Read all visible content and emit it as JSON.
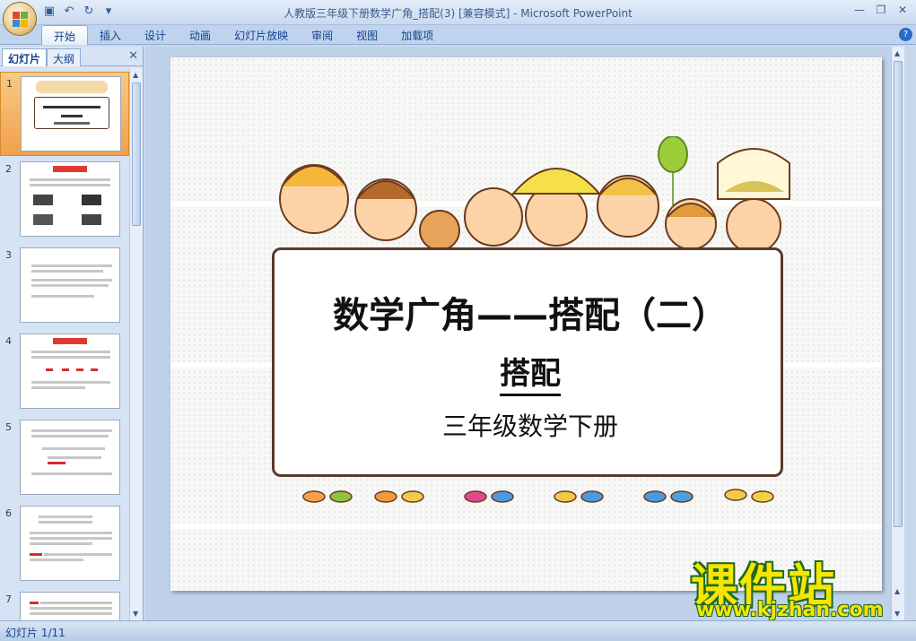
{
  "window": {
    "title": "人教版三年级下册数学广角_搭配(3) [兼容模式] - Microsoft PowerPoint"
  },
  "quick_access": {
    "icons": [
      "save-icon",
      "undo-icon",
      "redo-icon",
      "customize-icon"
    ]
  },
  "ribbon": {
    "tabs": [
      "开始",
      "插入",
      "设计",
      "动画",
      "幻灯片放映",
      "审阅",
      "视图",
      "加载项"
    ],
    "active_tab": "开始"
  },
  "panel": {
    "tab_slides": "幻灯片",
    "tab_outline": "大纲",
    "thumbnails": [
      {
        "number": "1",
        "selected": true
      },
      {
        "number": "2",
        "selected": false
      },
      {
        "number": "3",
        "selected": false
      },
      {
        "number": "4",
        "selected": false
      },
      {
        "number": "5",
        "selected": false
      },
      {
        "number": "6",
        "selected": false
      },
      {
        "number": "7",
        "selected": false
      }
    ]
  },
  "slide": {
    "title": "数学广角——搭配（二）",
    "subtitle": "搭配",
    "grade": "三年级数学下册"
  },
  "watermark": {
    "text": "课件站",
    "url": "www.kjzhan.com"
  },
  "status": {
    "slide_indicator": "幻灯片 1/11"
  },
  "colors": {
    "ribbon_bg": "#bfd3ee",
    "selected_thumb": "#f1a04a",
    "watermark_fill": "#f6e500",
    "watermark_stroke": "#1f6a1f"
  }
}
